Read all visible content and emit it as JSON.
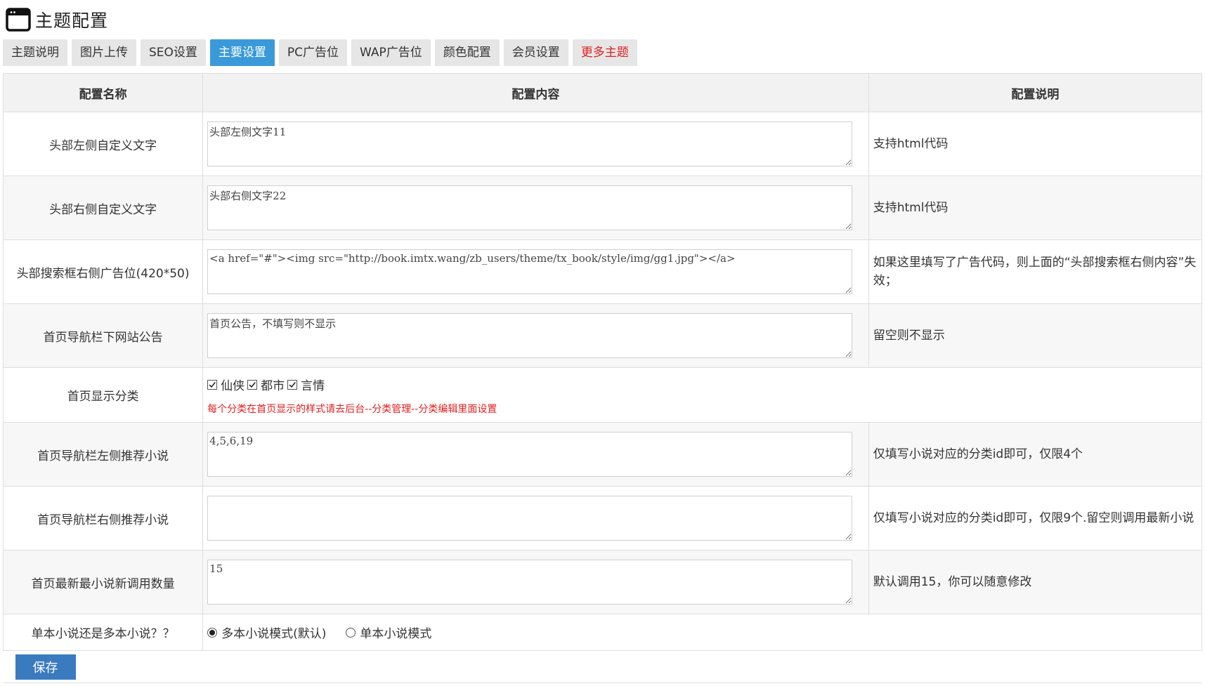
{
  "header": {
    "icon": "browser-window-icon",
    "title": "主题配置"
  },
  "tabs": [
    {
      "label": "主题说明",
      "state": "normal"
    },
    {
      "label": "图片上传",
      "state": "normal"
    },
    {
      "label": "SEO设置",
      "state": "normal"
    },
    {
      "label": "主要设置",
      "state": "active"
    },
    {
      "label": "PC广告位",
      "state": "normal"
    },
    {
      "label": "WAP广告位",
      "state": "normal"
    },
    {
      "label": "颜色配置",
      "state": "normal"
    },
    {
      "label": "会员设置",
      "state": "normal"
    },
    {
      "label": "更多主题",
      "state": "highlight"
    }
  ],
  "table": {
    "headers": {
      "name": "配置名称",
      "content": "配置内容",
      "desc": "配置说明"
    },
    "rows": [
      {
        "name": "头部左侧自定义文字",
        "value": "头部左侧文字11",
        "desc": "支持html代码"
      },
      {
        "name": "头部右侧自定义文字",
        "value": "头部右侧文字22",
        "desc": "支持html代码"
      },
      {
        "name": "头部搜索框右侧广告位(420*50)",
        "value": "<a href=\"#\"><img src=\"http://book.imtx.wang/zb_users/theme/tx_book/style/img/gg1.jpg\"></a>",
        "desc": "如果这里填写了广告代码，则上面的“头部搜索框右侧内容”失效；"
      },
      {
        "name": "首页导航栏下网站公告",
        "value": "首页公告，不填写则不显示",
        "desc": "留空则不显示"
      },
      {
        "name": "首页导航栏左侧推荐小说",
        "value": "4,5,6,19",
        "desc": "仅填写小说对应的分类id即可，仅限4个"
      },
      {
        "name": "首页导航栏右侧推荐小说",
        "value": "",
        "desc": "仅填写小说对应的分类id即可，仅限9个.留空则调用最新小说"
      },
      {
        "name": "首页最新最小说新调用数量",
        "value": "15",
        "desc": "默认调用15，你可以随意修改"
      }
    ],
    "categories_row": {
      "name": "首页显示分类",
      "options": [
        {
          "label": "仙侠",
          "checked": true
        },
        {
          "label": "都市",
          "checked": true
        },
        {
          "label": "言情",
          "checked": true
        }
      ],
      "hint": "每个分类在首页显示的样式请去后台--分类管理--分类编辑里面设置"
    },
    "mode_row": {
      "name": "单本小说还是多本小说？？",
      "options": [
        {
          "label": "多本小说模式(默认)",
          "selected": true
        },
        {
          "label": "单本小说模式",
          "selected": false
        }
      ]
    }
  },
  "save_label": "保存",
  "colors": {
    "active_tab": "#3a9ad9",
    "highlight_tab_text": "#e02020",
    "save_button": "#3a7bbf",
    "hint_text": "#e02020"
  }
}
